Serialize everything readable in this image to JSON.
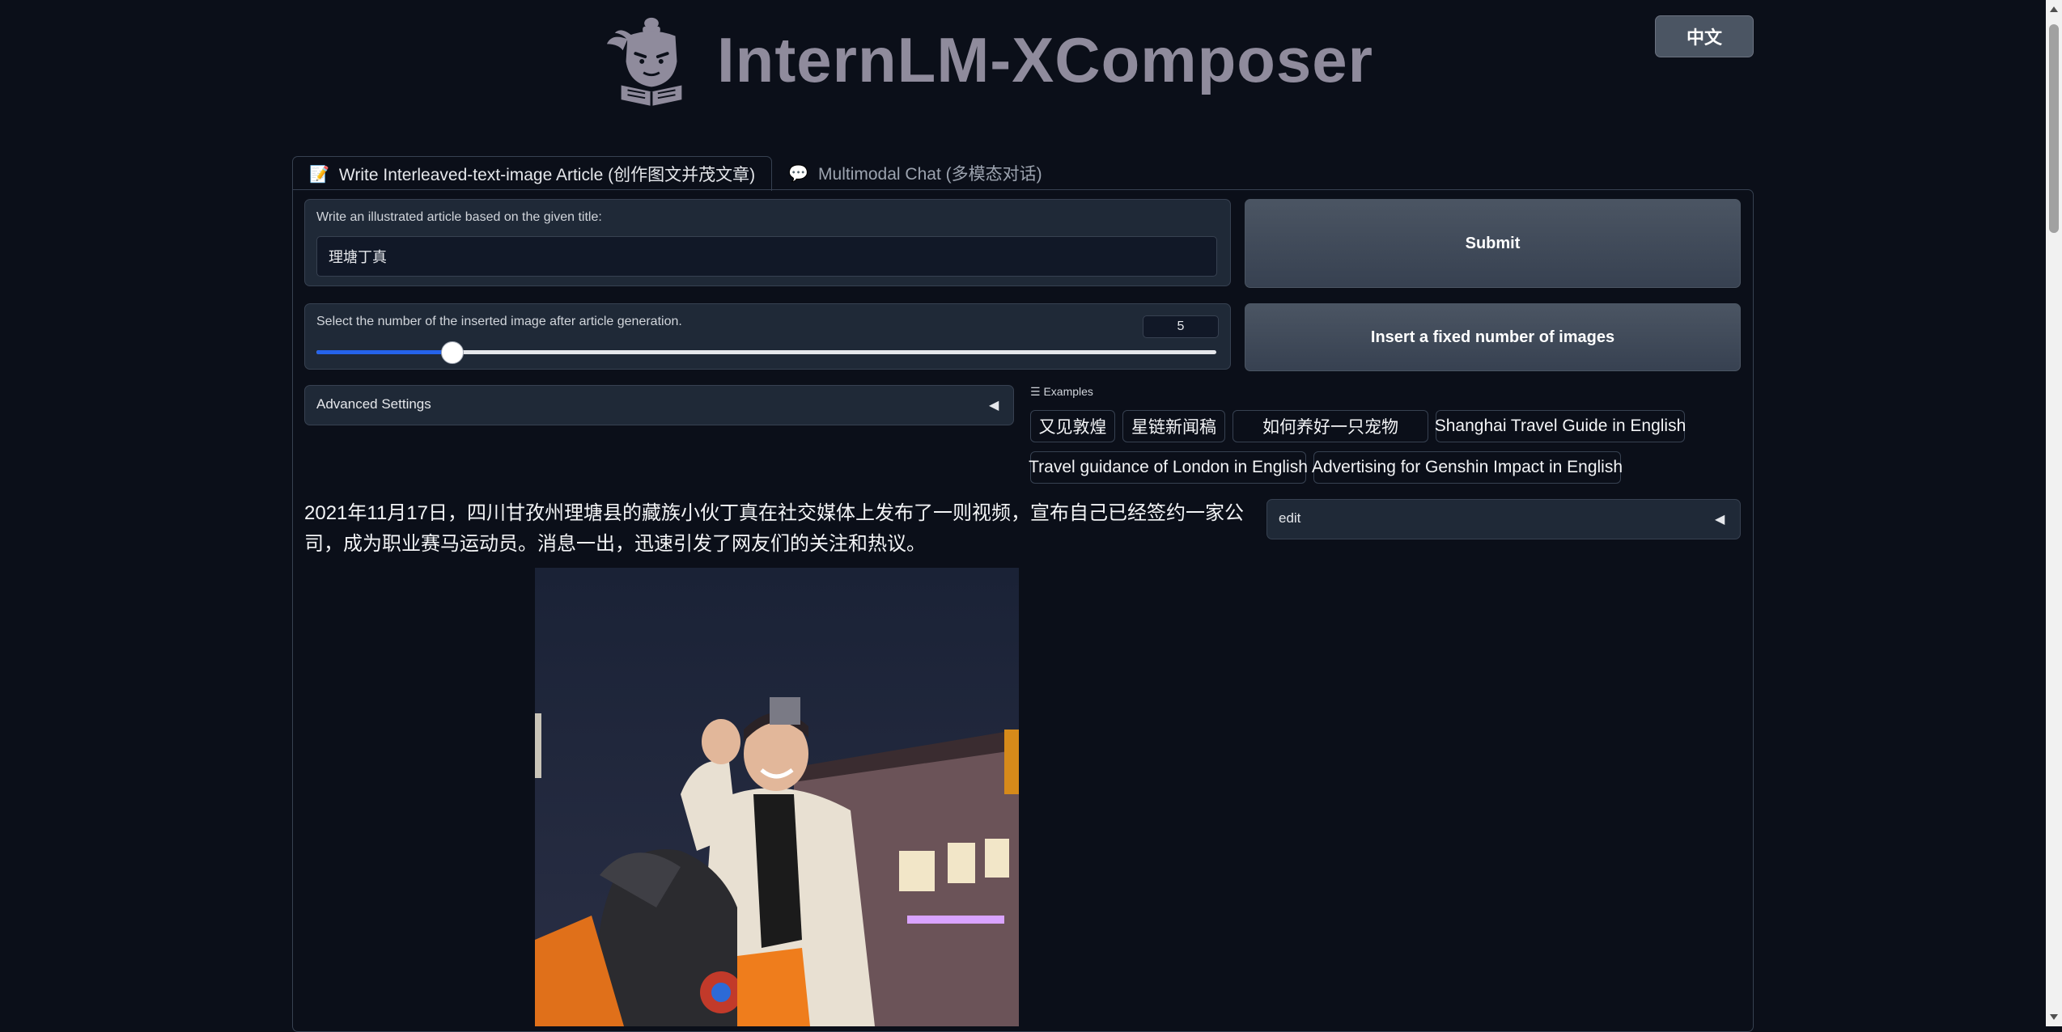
{
  "header": {
    "title": "InternLM-XComposer",
    "logo_icon": "mascot-logo-icon",
    "lang_button": "中文"
  },
  "tabs": [
    {
      "icon": "📝",
      "label": "Write Interleaved-text-image Article (创作图文并茂文章)",
      "active": true
    },
    {
      "icon": "💬",
      "label": "Multimodal Chat (多模态对话)",
      "active": false
    }
  ],
  "article_form": {
    "title_label": "Write an illustrated article based on the given title:",
    "title_value": "理塘丁真",
    "submit_label": "Submit",
    "image_count_label": "Select the number of the inserted image after article generation.",
    "image_count_value": "5",
    "image_count_fraction": 0.15,
    "insert_button_label": "Insert a fixed number of images",
    "advanced_settings_label": "Advanced Settings",
    "accordion_icon": "triangle-left-icon"
  },
  "examples": {
    "heading": "Examples",
    "items": [
      "又见敦煌",
      "星链新闻稿",
      "如何养好一只宠物",
      "Shanghai Travel Guide in English",
      "Travel guidance of London in English",
      "Advertising for Genshin Impact in English"
    ]
  },
  "output": {
    "paragraph": "2021年11月17日，四川甘孜州理塘县的藏族小伙丁真在社交媒体上发布了一则视频，宣布自己已经签约一家公司，成为职业赛马运动员。消息一出，迅速引发了网友们的关注和热议。",
    "edit_label": "edit",
    "image_icon": "photo-man-on-horse"
  },
  "colors": {
    "background": "#0b0f19",
    "panel": "#1f2937",
    "border": "#374151",
    "accent": "#2563eb"
  }
}
